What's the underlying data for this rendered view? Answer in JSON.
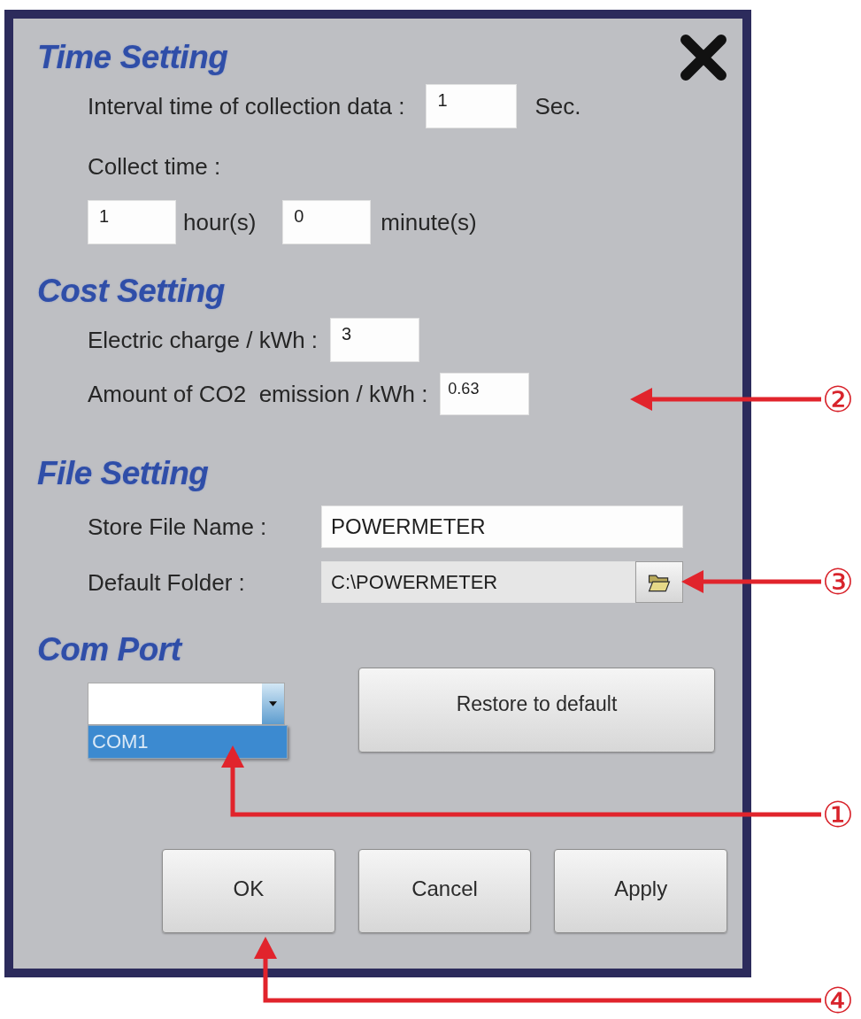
{
  "time_setting": {
    "title": "Time Setting",
    "interval": {
      "label": "Interval time of collection data :",
      "value": "1",
      "unit": "Sec."
    },
    "collect_time_label": "Collect time :",
    "hours": {
      "value": "1",
      "unit": "hour(s)"
    },
    "minutes": {
      "value": "0",
      "unit": "minute(s)"
    }
  },
  "cost_setting": {
    "title": "Cost Setting",
    "fields": [
      {
        "label": "Electric charge / kWh :",
        "value": "3"
      },
      {
        "label": "Amount of CO2  emission / kWh :",
        "value": "0.63"
      }
    ]
  },
  "file_setting": {
    "title": "File Setting",
    "store_file_name": {
      "label": "Store File Name :",
      "value": "POWERMETER"
    },
    "default_folder": {
      "label": "Default Folder :",
      "value": "C:\\POWERMETER"
    }
  },
  "com_port": {
    "title": "Com Port",
    "options": [
      {
        "label": "COM1",
        "selected": true
      }
    ]
  },
  "restore_button": "Restore to default",
  "buttons": [
    "OK",
    "Cancel",
    "Apply"
  ],
  "callouts": [
    "②",
    "③",
    "①",
    "④"
  ]
}
